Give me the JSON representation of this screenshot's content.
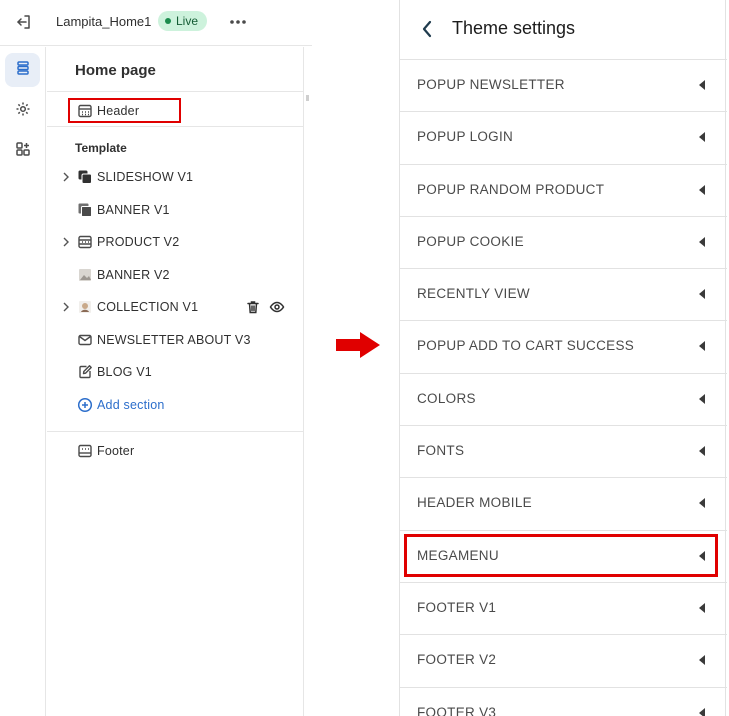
{
  "topbar": {
    "store_name": "Lampita_Home1",
    "live_label": "Live"
  },
  "editor": {
    "page_title": "Home page",
    "header_label": "Header",
    "template_label": "Template",
    "sections": [
      {
        "label": "SLIDESHOW V1",
        "icon": "slideshow-icon",
        "expandable": true
      },
      {
        "label": "BANNER V1",
        "icon": "image-icon",
        "expandable": false
      },
      {
        "label": "PRODUCT V2",
        "icon": "layout-icon",
        "expandable": true
      },
      {
        "label": "BANNER V2",
        "icon": "image-icon",
        "expandable": false
      },
      {
        "label": "COLLECTION V1",
        "icon": "collection-icon",
        "expandable": true
      },
      {
        "label": "NEWSLETTER ABOUT V3",
        "icon": "mail-icon",
        "expandable": false
      },
      {
        "label": "BLOG V1",
        "icon": "edit-icon",
        "expandable": false
      }
    ],
    "add_section_label": "Add section",
    "footer_label": "Footer"
  },
  "theme_settings": {
    "title": "Theme settings",
    "items": [
      "POPUP NEWSLETTER",
      "POPUP LOGIN",
      "POPUP RANDOM PRODUCT",
      "POPUP COOKIE",
      "RECENTLY VIEW",
      "POPUP ADD TO CART SUCCESS",
      "COLORS",
      "FONTS",
      "HEADER MOBILE",
      "MEGAMENU",
      "FOOTER V1",
      "FOOTER V2",
      "FOOTER V3"
    ]
  },
  "colors": {
    "accent_blue": "#2c6ecb",
    "highlight_red": "#e00000",
    "live_green": "#1a8b4c"
  }
}
